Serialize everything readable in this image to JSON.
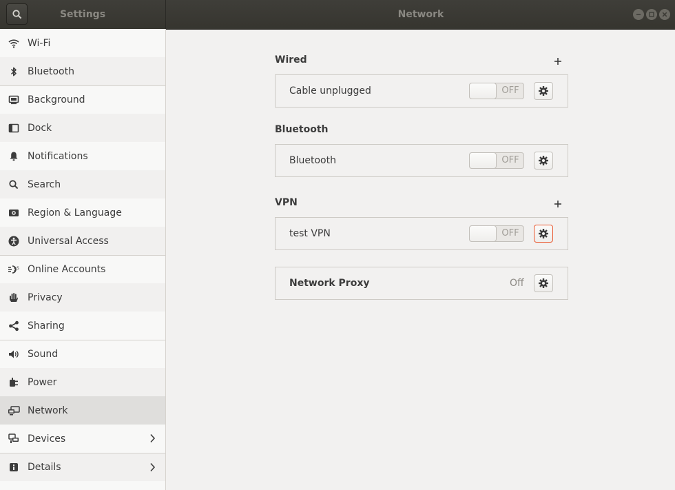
{
  "header": {
    "sidebar_title": "Settings",
    "title": "Network"
  },
  "sidebar": {
    "items": [
      {
        "label": "Wi-Fi",
        "icon": "wifi-icon"
      },
      {
        "label": "Bluetooth",
        "icon": "bluetooth-icon"
      },
      {
        "label": "Background",
        "icon": "background-icon"
      },
      {
        "label": "Dock",
        "icon": "dock-icon"
      },
      {
        "label": "Notifications",
        "icon": "bell-icon"
      },
      {
        "label": "Search",
        "icon": "search-icon"
      },
      {
        "label": "Region & Language",
        "icon": "camera-icon"
      },
      {
        "label": "Universal Access",
        "icon": "accessibility-icon"
      },
      {
        "label": "Online Accounts",
        "icon": "online-accounts-icon"
      },
      {
        "label": "Privacy",
        "icon": "hand-icon"
      },
      {
        "label": "Sharing",
        "icon": "share-icon"
      },
      {
        "label": "Sound",
        "icon": "speaker-icon"
      },
      {
        "label": "Power",
        "icon": "power-plug-icon"
      },
      {
        "label": "Network",
        "icon": "network-icon",
        "selected": true
      },
      {
        "label": "Devices",
        "icon": "devices-icon",
        "has_submenu": true
      },
      {
        "label": "Details",
        "icon": "info-icon",
        "has_submenu": true
      }
    ]
  },
  "wired": {
    "title": "Wired",
    "connection_label": "Cable unplugged",
    "switch_label": "OFF"
  },
  "bluetooth": {
    "title": "Bluetooth",
    "connection_label": "Bluetooth",
    "switch_label": "OFF"
  },
  "vpn": {
    "title": "VPN",
    "connection_label": "test VPN",
    "switch_label": "OFF"
  },
  "proxy": {
    "label": "Network Proxy",
    "status": "Off"
  },
  "colors": {
    "header_bg": "#3d3c37",
    "content_bg": "#f2f1f0",
    "focus_accent": "#e9562d",
    "selected_row": "#dfdedc"
  }
}
